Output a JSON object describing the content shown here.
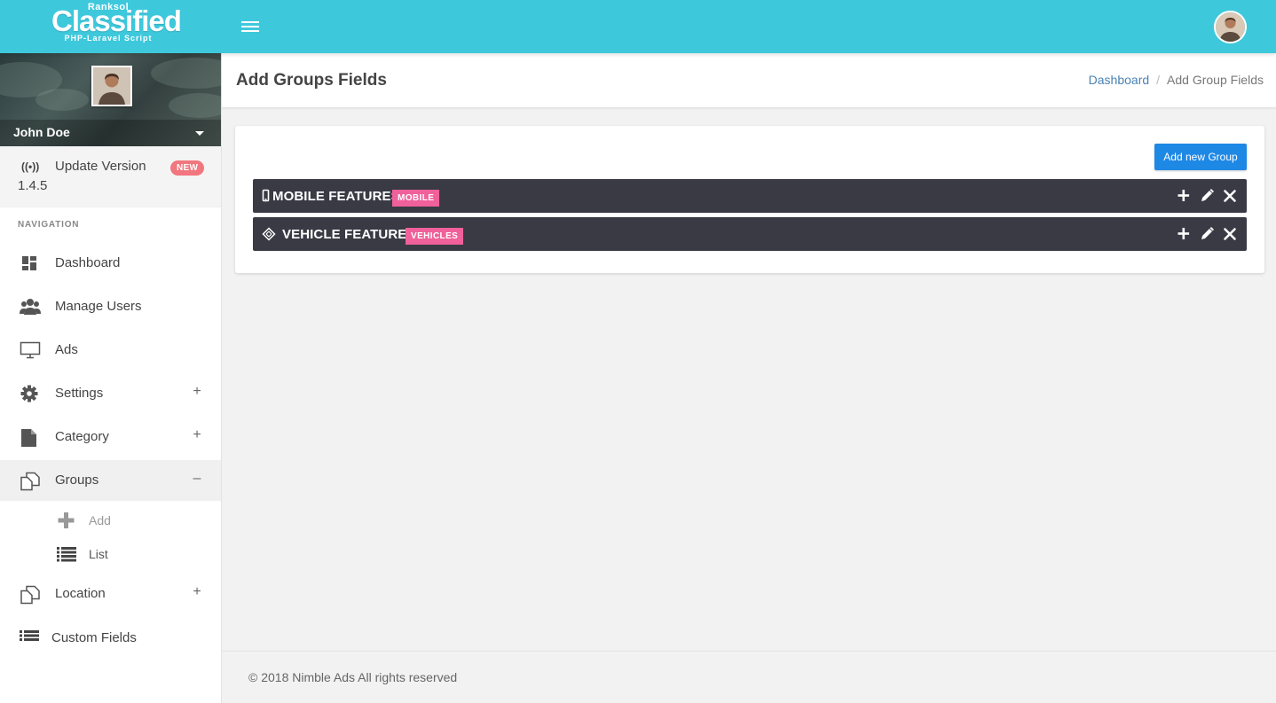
{
  "logo": {
    "brand_small": "Ranksol",
    "brand_main": "Classified",
    "brand_sub": "PHP-Laravel Script"
  },
  "user": {
    "name": "John Doe"
  },
  "update": {
    "label": "Update Version",
    "version": "1.4.5",
    "badge": "NEW",
    "badge_color": "#f2767e"
  },
  "sidebar": {
    "nav_heading": "NAVIGATION",
    "items": [
      {
        "label": "Dashboard",
        "icon": "dashboard-icon",
        "toggle": ""
      },
      {
        "label": "Manage Users",
        "icon": "users-icon",
        "toggle": ""
      },
      {
        "label": "Ads",
        "icon": "monitor-icon",
        "toggle": ""
      },
      {
        "label": "Settings",
        "icon": "gear-icon",
        "toggle": "+"
      },
      {
        "label": "Category",
        "icon": "file-icon",
        "toggle": "+"
      },
      {
        "label": "Groups",
        "icon": "copy-icon",
        "toggle": "–"
      },
      {
        "label": "Location",
        "icon": "copy-icon",
        "toggle": "+"
      },
      {
        "label": "Custom Fields",
        "icon": "list-icon",
        "toggle": ""
      }
    ],
    "groups_sub": [
      {
        "label": "Add",
        "icon": "plus-icon"
      },
      {
        "label": "List",
        "icon": "list-icon"
      }
    ]
  },
  "page": {
    "title": "Add Groups Fields",
    "breadcrumb": [
      "Dashboard",
      "Add Group Fields"
    ]
  },
  "card": {
    "add_button": "Add new Group",
    "groups": [
      {
        "title": "MOBILE FEATURES",
        "tag": "MOBILE",
        "icon": "mobile-icon"
      },
      {
        "title": "VEHICLE FEATURES",
        "tag": "VEHICLES",
        "icon": "diamond-arrows-icon"
      }
    ]
  },
  "footer": {
    "text": "© 2018 Nimble Ads All rights reserved"
  },
  "colors": {
    "topbar": "#3ec8dc",
    "primary_button": "#1e88e5",
    "group_row": "#393a44",
    "group_tag": "#f0609a"
  }
}
